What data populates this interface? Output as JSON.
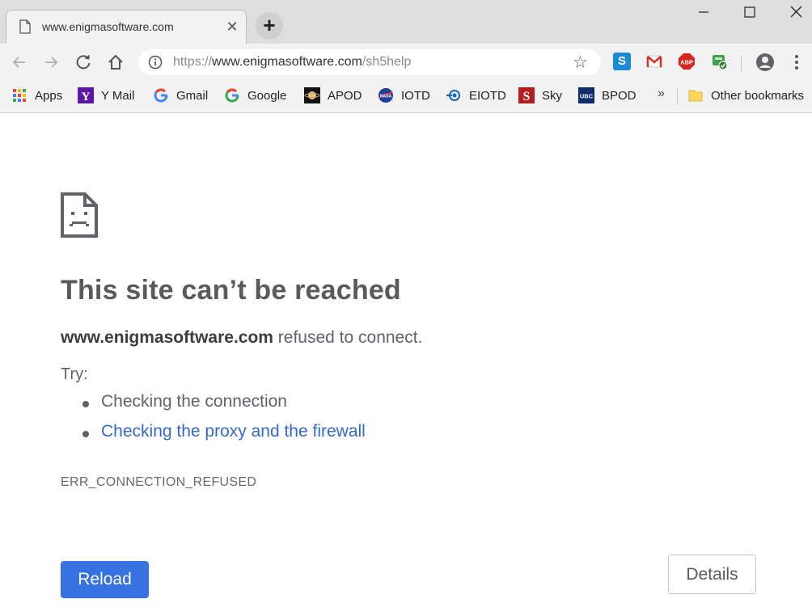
{
  "browser": {
    "tab": {
      "title": "www.enigmasoftware.com",
      "favicon": "page-icon",
      "close_glyph": "✕"
    },
    "new_tab_glyph": "+",
    "window_controls": {
      "minimize": "minimize-icon",
      "maximize": "maximize-icon",
      "close": "close-icon"
    },
    "omnibox": {
      "url_scheme": "https://",
      "url_host": "www.enigmasoftware.com",
      "url_path": "/sh5help"
    },
    "extensions": [
      "skype-icon",
      "gmail-checker-icon",
      "adblock-plus-icon",
      "green-extension-icon"
    ],
    "bookmarks": [
      {
        "label": "Apps",
        "icon": "apps-grid-icon"
      },
      {
        "label": "Y Mail",
        "icon": "yahoo-icon"
      },
      {
        "label": "Gmail",
        "icon": "google-icon"
      },
      {
        "label": "Google",
        "icon": "google-icon"
      },
      {
        "label": "APOD",
        "icon": "apod-icon"
      },
      {
        "label": "IOTD",
        "icon": "nasa-icon"
      },
      {
        "label": "EIOTD",
        "icon": "eiotd-icon"
      },
      {
        "label": "Sky",
        "icon": "sky-icon"
      },
      {
        "label": "BPOD",
        "icon": "ubc-icon"
      }
    ],
    "bookmarks_overflow": "»",
    "other_bookmarks": "Other bookmarks"
  },
  "error_page": {
    "title": "This site can’t be reached",
    "host": "www.enigmasoftware.com",
    "message_suffix": " refused to connect.",
    "try_label": "Try:",
    "suggestions": [
      "Checking the connection",
      "Checking the proxy and the firewall"
    ],
    "error_code": "ERR_CONNECTION_REFUSED",
    "reload_label": "Reload",
    "details_label": "Details"
  },
  "colors": {
    "accent_blue": "#3673e0",
    "link_blue": "#3369c7",
    "chrome_bg": "#f2f2f2",
    "tabstrip_bg": "#dedede"
  }
}
